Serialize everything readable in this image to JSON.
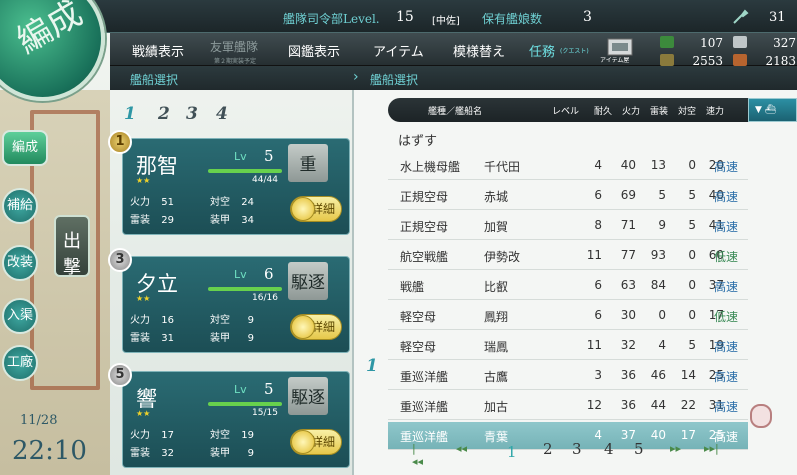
{
  "header": {
    "hq_label": "艦隊司令部Level.",
    "hq_level": "15",
    "rank": "[中佐]",
    "ship_count_label": "保有艦娘数",
    "ship_count": "3",
    "repair_buckets": "31"
  },
  "menu": {
    "items": [
      "戦績表示",
      "友軍艦隊",
      "図鑑表示",
      "アイテム",
      "模様替え",
      "任務"
    ],
    "friend_sub": "第２期実装予定",
    "quest_sub": "(クエスト)",
    "furniture_label": "アイテム屋"
  },
  "resources": {
    "fuel": "107",
    "ammo": "2553",
    "steel": "327",
    "bauxite": "2183"
  },
  "section": {
    "left": "艦船選択",
    "right": "艦船選択"
  },
  "hexagon_label": "編成",
  "sidebar": {
    "items": [
      "編成",
      "補給",
      "改装",
      "入渠",
      "工廠"
    ],
    "sortie": "出撃"
  },
  "clock": {
    "date": "11/28",
    "time": "22:10"
  },
  "fleet_tabs": [
    "1",
    "2",
    "3",
    "4"
  ],
  "fleet": [
    {
      "slot": "1",
      "name": "那智",
      "lv_label": "Lv",
      "lv": "5",
      "hp": "44/44",
      "class": "重",
      "firepower_label": "火力",
      "firepower": "51",
      "aa_label": "対空",
      "aa": "24",
      "torpedo_label": "雷装",
      "torpedo": "29",
      "armor_label": "装甲",
      "armor": "34",
      "detail": "詳細"
    },
    {
      "slot": "3",
      "name": "夕立",
      "lv_label": "Lv",
      "lv": "6",
      "hp": "16/16",
      "class": "駆逐",
      "firepower_label": "火力",
      "firepower": "16",
      "aa_label": "対空",
      "aa": "9",
      "torpedo_label": "雷装",
      "torpedo": "31",
      "armor_label": "装甲",
      "armor": "9",
      "detail": "詳細"
    },
    {
      "slot": "5",
      "name": "響",
      "lv_label": "Lv",
      "lv": "5",
      "hp": "15/15",
      "class": "駆逐",
      "firepower_label": "火力",
      "firepower": "17",
      "aa_label": "対空",
      "aa": "19",
      "torpedo_label": "雷装",
      "torpedo": "32",
      "armor_label": "装甲",
      "armor": "9",
      "detail": "詳細"
    }
  ],
  "list": {
    "headers": {
      "type_name": "艦種／艦船名",
      "level": "レベル",
      "hp": "耐久",
      "firepower": "火力",
      "torpedo": "雷装",
      "aa": "対空",
      "speed": "速力"
    },
    "remove": "はずす",
    "fleet_mark": "1",
    "rows": [
      {
        "type": "水上機母艦",
        "name": "千代田",
        "lv": "4",
        "hp": "40",
        "fp": "13",
        "tp": "0",
        "aa": "20",
        "speed": "高速",
        "fast": true
      },
      {
        "type": "正規空母",
        "name": "赤城",
        "lv": "6",
        "hp": "69",
        "fp": "5",
        "tp": "5",
        "aa": "40",
        "speed": "高速",
        "fast": true
      },
      {
        "type": "正規空母",
        "name": "加賀",
        "lv": "8",
        "hp": "71",
        "fp": "9",
        "tp": "5",
        "aa": "41",
        "speed": "高速",
        "fast": true
      },
      {
        "type": "航空戦艦",
        "name": "伊勢改",
        "lv": "11",
        "hp": "77",
        "fp": "93",
        "tp": "0",
        "aa": "60",
        "speed": "低速",
        "fast": false
      },
      {
        "type": "戦艦",
        "name": "比叡",
        "lv": "6",
        "hp": "63",
        "fp": "84",
        "tp": "0",
        "aa": "37",
        "speed": "高速",
        "fast": true
      },
      {
        "type": "軽空母",
        "name": "鳳翔",
        "lv": "6",
        "hp": "30",
        "fp": "0",
        "tp": "0",
        "aa": "17",
        "speed": "低速",
        "fast": false
      },
      {
        "type": "軽空母",
        "name": "瑞鳳",
        "lv": "11",
        "hp": "32",
        "fp": "4",
        "tp": "5",
        "aa": "19",
        "speed": "高速",
        "fast": true
      },
      {
        "type": "重巡洋艦",
        "name": "古鷹",
        "lv": "3",
        "hp": "36",
        "fp": "46",
        "tp": "14",
        "aa": "25",
        "speed": "高速",
        "fast": true
      },
      {
        "type": "重巡洋艦",
        "name": "加古",
        "lv": "12",
        "hp": "36",
        "fp": "44",
        "tp": "22",
        "aa": "31",
        "speed": "高速",
        "fast": true
      },
      {
        "type": "重巡洋艦",
        "name": "青葉",
        "lv": "4",
        "hp": "37",
        "fp": "40",
        "tp": "17",
        "aa": "25",
        "speed": "高速",
        "fast": true
      }
    ]
  },
  "pager": {
    "pages": [
      "1",
      "2",
      "3",
      "4",
      "5"
    ],
    "current": "1"
  },
  "colors": {
    "accent": "#2ea6a8",
    "header_text": "#6fd0d3",
    "fast_speed": "#2a6ea8",
    "slow_speed": "#3a8a55"
  }
}
